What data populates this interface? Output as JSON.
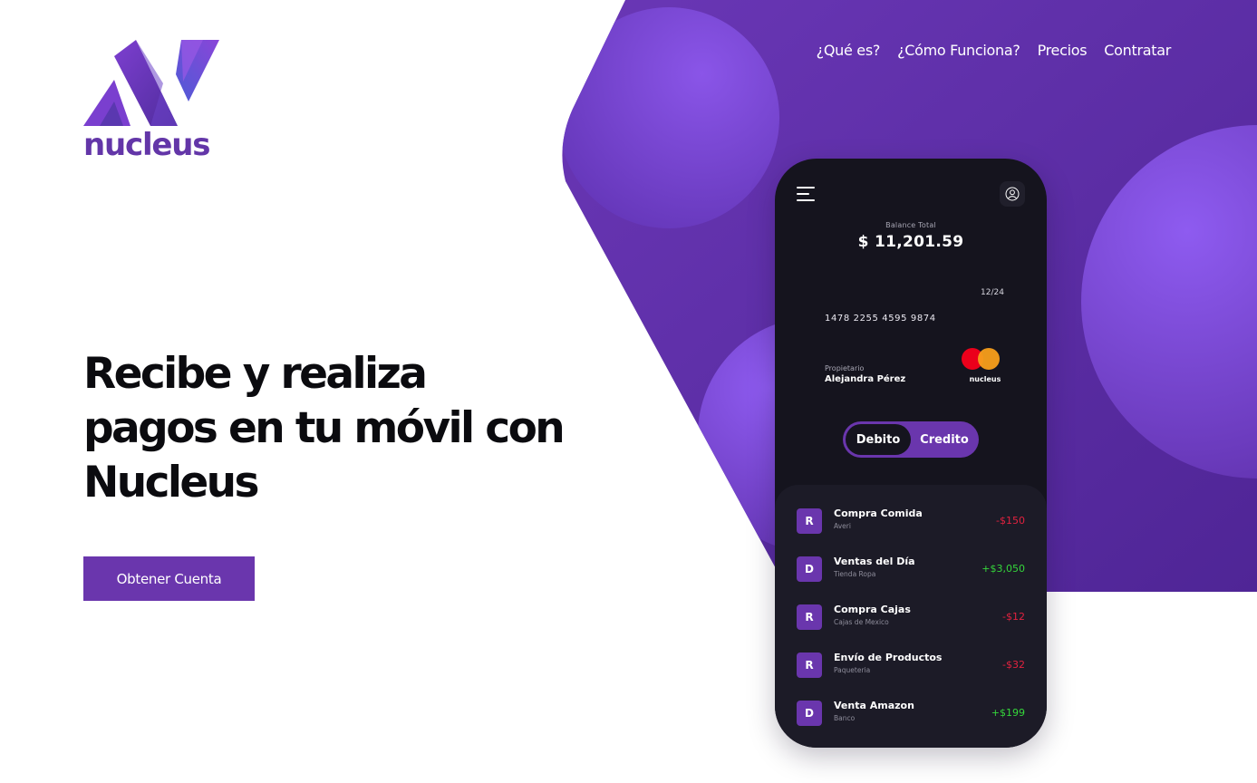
{
  "brand": {
    "name": "nucleus"
  },
  "nav": {
    "items": [
      {
        "label": "¿Qué es?"
      },
      {
        "label": "¿Cómo Funciona?"
      },
      {
        "label": "Precios"
      },
      {
        "label": "Contratar"
      }
    ]
  },
  "hero": {
    "headline_lines": [
      "Recibe y realiza",
      "pagos en tu móvil con",
      "Nucleus"
    ],
    "cta_label": "Obtener Cuenta"
  },
  "phone": {
    "balance_label": "Balance Total",
    "balance_amount": "$ 11,201.59",
    "card": {
      "expiry": "12/24",
      "number": "1478 2255 4595 9874",
      "owner_label": "Propietario",
      "owner_name": "Alejandra Pérez",
      "brand_name": "nucleus"
    },
    "toggle": {
      "options": [
        "Debito",
        "Credito"
      ],
      "selected": "Debito"
    },
    "transactions": [
      {
        "badge": "R",
        "title": "Compra Comida",
        "subtitle": "Averi",
        "amount": "-$150",
        "type": "negative"
      },
      {
        "badge": "D",
        "title": "Ventas del Día",
        "subtitle": "Tienda Ropa",
        "amount": "+$3,050",
        "type": "positive"
      },
      {
        "badge": "R",
        "title": "Compra Cajas",
        "subtitle": "Cajas de Mexico",
        "amount": "-$12",
        "type": "negative"
      },
      {
        "badge": "R",
        "title": "Envío de Productos",
        "subtitle": "Paqueteria",
        "amount": "-$32",
        "type": "negative"
      },
      {
        "badge": "D",
        "title": "Venta Amazon",
        "subtitle": "Banco",
        "amount": "+$199",
        "type": "positive"
      }
    ]
  },
  "colors": {
    "primary": "#6a36ad",
    "hero_purple": "#5d30a8",
    "phone_bg": "#15141e",
    "amount_negative": "#e2223f",
    "amount_positive": "#35d63b",
    "mastercard_red": "#eb001b",
    "mastercard_orange": "#f79e1b"
  },
  "icons": {
    "menu": "hamburger-menu-icon",
    "user": "user-circle-icon"
  }
}
